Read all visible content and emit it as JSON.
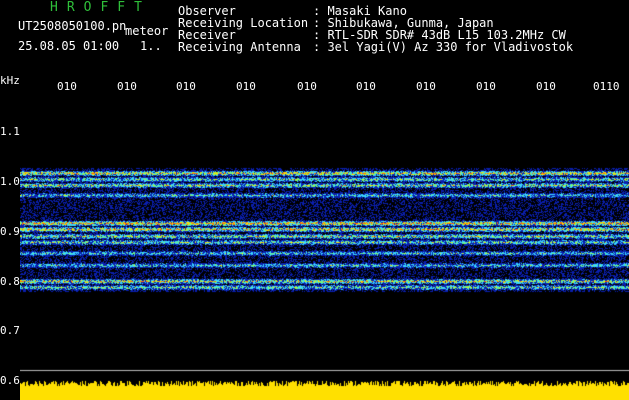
{
  "header": {
    "brand": "HROFFT",
    "filename": "UT2508050100.pn",
    "mode": "meteor",
    "datetime": "25.08.05 01:00",
    "counter": "1..",
    "fields": [
      {
        "label": "Observer",
        "value": ": Masaki Kano"
      },
      {
        "label": "Receiving Location",
        "value": ": Shibukawa, Gunma, Japan"
      },
      {
        "label": "Receiver",
        "value": ": RTL-SDR SDR# 43dB L15 103.2MHz CW"
      },
      {
        "label": "Receiving Antenna",
        "value": ": 3el Yagi(V) Az 330 for Vladivostok"
      }
    ]
  },
  "axis": {
    "unit": "kHz",
    "y_ticks": [
      "1.1",
      "1.0",
      "0.9",
      "0.8",
      "0.7",
      "0.6"
    ],
    "time_ticks": [
      "010",
      "010",
      "010",
      "010",
      "010",
      "010",
      "010",
      "010",
      "010",
      "0110"
    ]
  },
  "colors": {
    "background": "#000000",
    "noise": "#0a1fb0",
    "signal": "#39d6ff",
    "peak": "#ffe000",
    "brand": "#2fbf3a"
  }
}
